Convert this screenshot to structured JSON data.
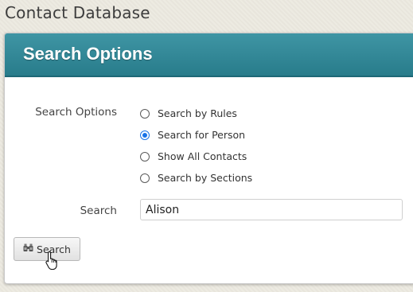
{
  "page": {
    "title": "Contact Database"
  },
  "panel": {
    "title": "Search Options",
    "header_color": "#2f8795"
  },
  "search_options": {
    "label": "Search Options",
    "selected": "Search for Person",
    "options": [
      {
        "label": "Search by Rules",
        "checked": false
      },
      {
        "label": "Search for Person",
        "checked": true
      },
      {
        "label": "Show All Contacts",
        "checked": false
      },
      {
        "label": "Search by Sections",
        "checked": false
      }
    ]
  },
  "search": {
    "label": "Search",
    "value": "Alison"
  },
  "button": {
    "label": "Search",
    "icon": "binoculars-icon"
  },
  "accent_color": "#1a73e8"
}
